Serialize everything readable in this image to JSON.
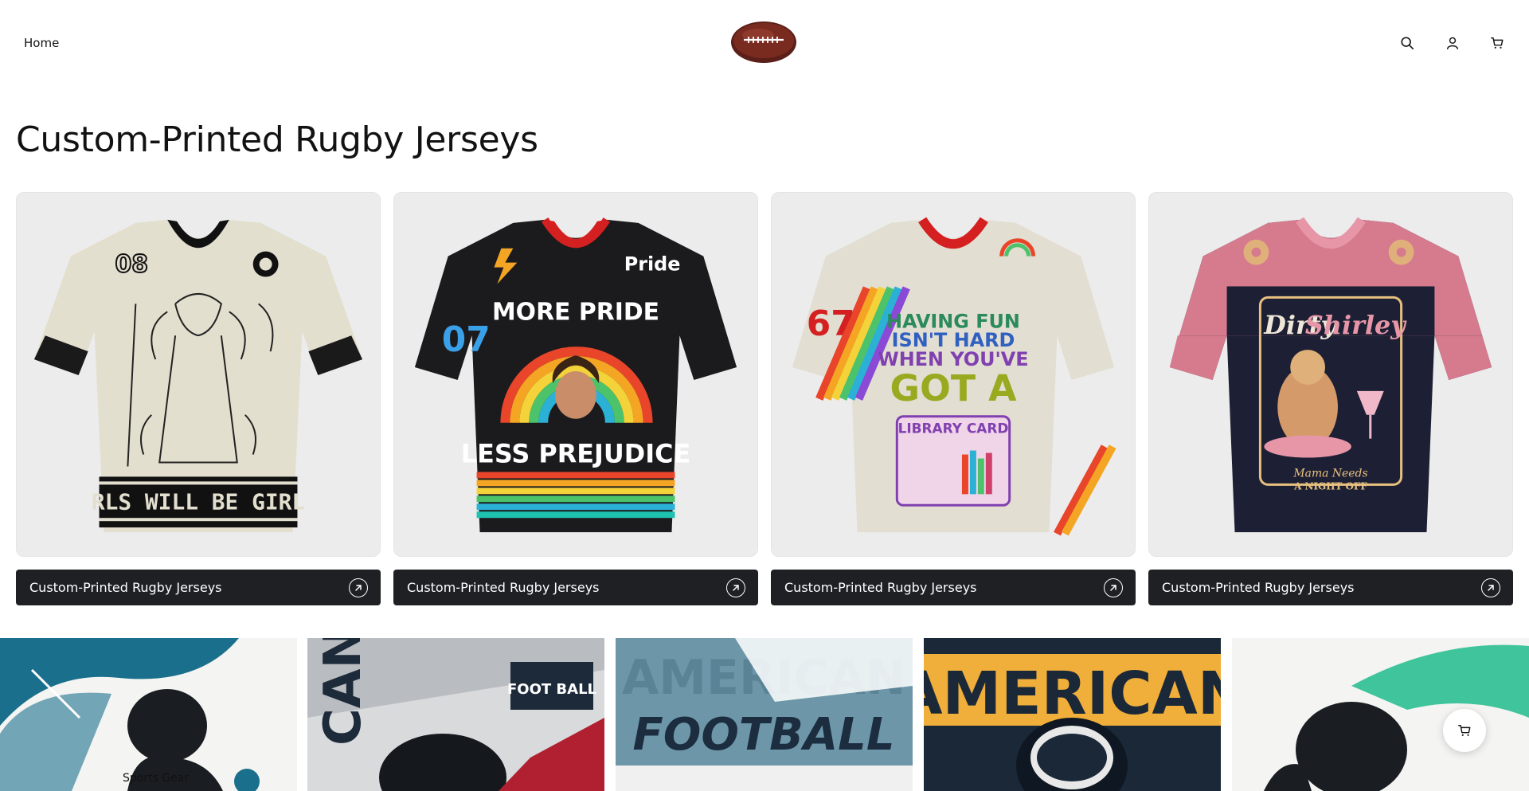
{
  "header": {
    "nav_home": "Home",
    "logo_icon": "rugby-ball-icon",
    "icons": [
      "search-icon",
      "account-icon",
      "cart-icon"
    ]
  },
  "page": {
    "title": "Custom-Printed Rugby Jerseys"
  },
  "collections": [
    {
      "label": "Custom-Printed Rugby Jerseys",
      "jersey_number": "08",
      "print_text": "RLS WILL BE GIRL",
      "icon": "arrow-up-right-icon"
    },
    {
      "label": "Custom-Printed Rugby Jerseys",
      "jersey_number": "07",
      "print_text": "MORE PRIDE",
      "print_text_2": "LESS PREJUDICE",
      "patch_text": "Pride",
      "icon": "arrow-up-right-icon"
    },
    {
      "label": "Custom-Printed Rugby Jerseys",
      "jersey_number": "67",
      "print_text": "HAVING FUN",
      "print_text_2": "ISN'T HARD",
      "print_text_3": "WHEN YOU'VE",
      "print_text_4": "GOT A",
      "print_text_5": "LIBRARY CARD",
      "icon": "arrow-up-right-icon"
    },
    {
      "label": "Custom-Printed Rugby Jerseys",
      "print_text": "Dirty",
      "print_text_2": "Shirley",
      "print_text_3": "Mama Needs",
      "print_text_4": "A NIGHT OFF",
      "icon": "arrow-up-right-icon"
    }
  ],
  "banner": {
    "tiles": [
      {
        "text": ""
      },
      {
        "text": "FOOT BALL",
        "side_text": "CAN"
      },
      {
        "text": "FOOTBALL",
        "bg_text": "AMERICAN"
      },
      {
        "text": "AMERICAN"
      },
      {
        "text": ""
      }
    ],
    "caption": "Sports Gear"
  },
  "floating_cart_icon": "cart-icon",
  "colors": {
    "bar_bg": "#1f2024",
    "card_bg": "#ececec"
  }
}
